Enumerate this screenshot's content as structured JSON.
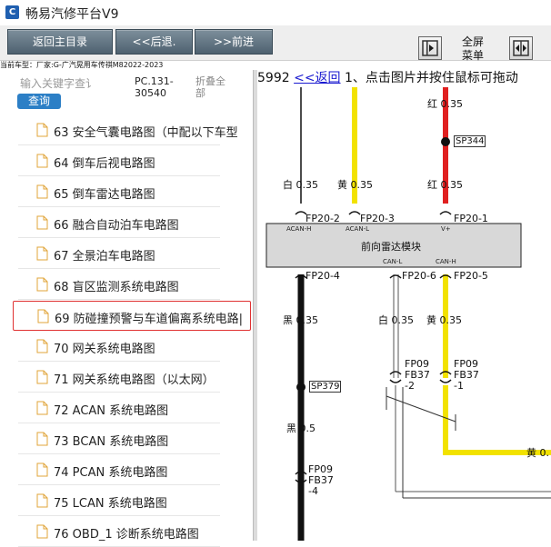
{
  "app": {
    "title": "畅易汽修平台V9",
    "icon": "app-logo-icon"
  },
  "toolbar": {
    "home_label": "返回主目录",
    "back_label": "<<后退.",
    "forward_label": ">>前进",
    "fullscreen_label": "全屏",
    "menu_label": "菜单"
  },
  "vehicle_line": "当前车型：厂家:G-广汽晃用车传祺M82022-2023",
  "sidebar": {
    "search_placeholder": "输入关键字查讠",
    "search_button": "查询",
    "code": "PC.131-30540",
    "collapse": "折叠全部",
    "items": [
      {
        "label": "63 安全气囊电路图（中配以下车型"
      },
      {
        "label": "64 倒车后视电路图"
      },
      {
        "label": "65 倒车雷达电路图"
      },
      {
        "label": "66 融合自动泊车电路图"
      },
      {
        "label": "67 全景泊车电路图"
      },
      {
        "label": "68 盲区监测系统电路图"
      },
      {
        "label": "69 防碰撞预警与车道偏离系统电路|",
        "selected": true
      },
      {
        "label": "70 网关系统电路图"
      },
      {
        "label": "71 网关系统电路图（以太网）"
      },
      {
        "label": "72 ACAN 系统电路图"
      },
      {
        "label": "73 BCAN 系统电路图"
      },
      {
        "label": "74 PCAN 系统电路图"
      },
      {
        "label": "75 LCAN 系统电路图"
      },
      {
        "label": "76 OBD_1 诊断系统电路图"
      }
    ]
  },
  "diagram": {
    "header_num": "5992",
    "back_link": "<<返回",
    "instruction": "1、点击图片并按住鼠标可拖动",
    "module_name": "前向雷达模块",
    "colors": {
      "red": "#e02020",
      "yellow": "#f2e200",
      "black": "#111111",
      "white_wire": "#ffffff"
    },
    "labels": {
      "red_top": "红  0.35",
      "sp344": "SP344",
      "white_1": "白  0.35",
      "yellow_1": "黄  0.35",
      "red_2": "红  0.35",
      "fp20_2": "FP20-2",
      "fp20_3": "FP20-3",
      "fp20_1": "FP20-1",
      "acan_h": "ACAN-H",
      "acan_l": "ACAN-L",
      "vplus": "V+",
      "can_l": "CAN-L",
      "can_h": "CAN-H",
      "fp20_4": "FP20-4",
      "fp20_6": "FP20-6",
      "fp20_5": "FP20-5",
      "black_1": "黑  0.35",
      "white_2": "白  0.35",
      "yellow_2": "黄  0.35",
      "fp09_a": "FP09",
      "fb37_a": "FB37",
      "pin_a": "-2",
      "fp09_b": "FP09",
      "fb37_b": "FB37",
      "pin_b": "-1",
      "sp379": "SP379",
      "black_2": "黑  0.5",
      "fp09_c": "FP09",
      "fb37_c": "FB37",
      "pin_c": "-4",
      "yellow_end": "黄  0."
    }
  }
}
